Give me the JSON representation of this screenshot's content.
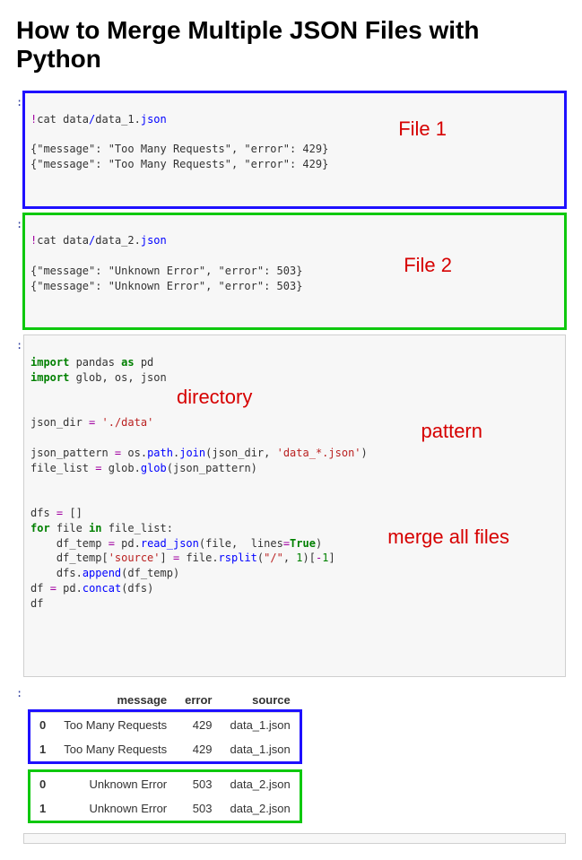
{
  "title": "How to Merge Multiple JSON Files with Python",
  "annotations": {
    "file1": "File 1",
    "file2": "File 2",
    "directory": "directory",
    "pattern": "pattern",
    "merge": "merge all files"
  },
  "code": {
    "cat1_bang": "!",
    "cat1_cmd": "cat data",
    "cat1_slash": "/",
    "cat1_file": "data_1.",
    "cat1_ext": "json",
    "out1_l1": "{\"message\": \"Too Many Requests\", \"error\": 429}",
    "out1_l2": "{\"message\": \"Too Many Requests\", \"error\": 429}",
    "cat2_bang": "!",
    "cat2_cmd": "cat data",
    "cat2_slash": "/",
    "cat2_file": "data_2.",
    "cat2_ext": "json",
    "out2_l1": "{\"message\": \"Unknown Error\", \"error\": 503}",
    "out2_l2": "{\"message\": \"Unknown Error\", \"error\": 503}",
    "imp": "import",
    "as": "as",
    "pandas": " pandas ",
    "pd": " pd",
    "glob_os_json": " glob, os, json",
    "json_dir": "json_dir ",
    "eq": "=",
    "path_data": " './data'",
    "json_pattern": "json_pattern ",
    "os_path": " os",
    "dot1": ".",
    "path_attr": "path",
    "dot2": ".",
    "join_fn": "join",
    "lp1": "(json_dir, ",
    "glob_str": "'data_*.json'",
    "rp1": ")",
    "file_list": "file_list ",
    "glob_mod": " glob",
    "dot3": ".",
    "glob_fn": "glob",
    "lp2": "(json_pattern)",
    "dfs": "dfs ",
    "empty_list": " []",
    "for": "for",
    "file_in": " file ",
    "in": "in",
    "file_list_colon": " file_list:",
    "df_temp": "    df_temp ",
    "pd_read": " pd",
    "dot4": ".",
    "read_json": "read_json",
    "lp3": "(file,  lines",
    "eq2": "=",
    "true": "True",
    "rp3": ")",
    "df_temp_src_l": "    df_temp[",
    "src_str": "'source'",
    "df_temp_src_r": "] ",
    "file_rsplit": " file",
    "dot5": ".",
    "rsplit": "rsplit",
    "lp4": "(",
    "slash_str": "\"/\"",
    "comma_1": ", ",
    "one": "1",
    "rp4": ")[",
    "neg1_a": "-",
    "neg1_b": "1",
    "rb": "]",
    "dfs_append": "    dfs",
    "dot6": ".",
    "append_fn": "append",
    "lp5": "(df_temp)",
    "df_eq": "df ",
    "pd_concat": " pd",
    "dot7": ".",
    "concat_fn": "concat",
    "lp6": "(dfs)",
    "df_last": "df"
  },
  "table": {
    "h_msg": "message",
    "h_err": "error",
    "h_src": "source",
    "r0_idx": "0",
    "r0_msg": "Too Many Requests",
    "r0_err": "429",
    "r0_src": "data_1.json",
    "r1_idx": "1",
    "r1_msg": "Too Many Requests",
    "r1_err": "429",
    "r1_src": "data_1.json",
    "r2_idx": "0",
    "r2_msg": "Unknown Error",
    "r2_err": "503",
    "r2_src": "data_2.json",
    "r3_idx": "1",
    "r3_msg": "Unknown Error",
    "r3_err": "503",
    "r3_src": "data_2.json"
  }
}
